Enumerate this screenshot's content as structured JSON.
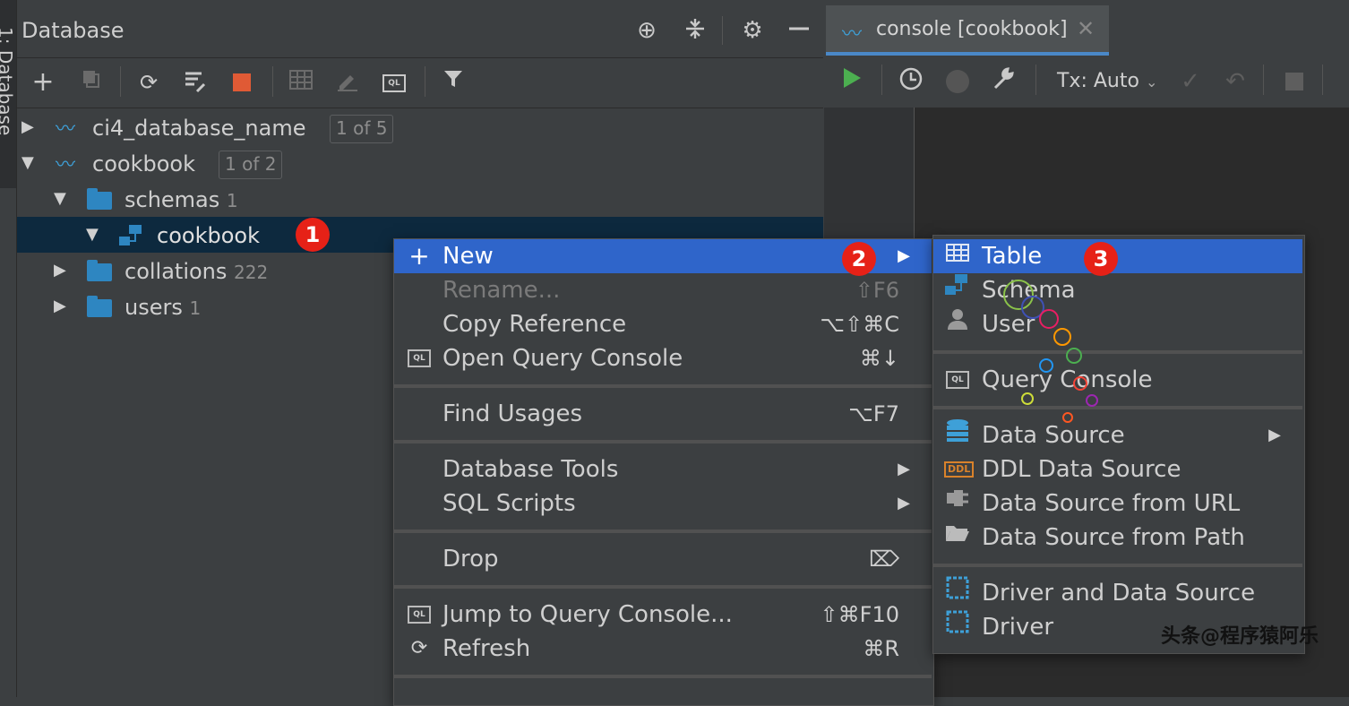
{
  "left_strip": {
    "label": "1: Database"
  },
  "db_panel": {
    "title": "Database",
    "header_icons": [
      "crosshair-icon",
      "collapse-icon",
      "gear-icon",
      "minimize-icon"
    ],
    "toolbar_icons": [
      "add-icon",
      "duplicate-icon",
      "refresh-icon",
      "schema-tools-icon",
      "stop-icon",
      "table-icon",
      "edit-icon",
      "console-icon",
      "filter-icon"
    ],
    "tree": [
      {
        "label": "ci4_database_name",
        "badge": "1 of 5",
        "expanded": false
      },
      {
        "label": "cookbook",
        "badge": "1 of 2",
        "expanded": true
      },
      {
        "label": "schemas",
        "count": "1",
        "expanded": true
      },
      {
        "label": "cookbook",
        "marker": "1",
        "selected": true,
        "expanded": true
      },
      {
        "label": "collations",
        "count": "222",
        "expanded": false
      },
      {
        "label": "users",
        "count": "1",
        "expanded": false
      }
    ]
  },
  "console": {
    "tab_label": "console [cookbook]",
    "tx_label": "Tx: Auto",
    "toolbar_icons": [
      "run-icon",
      "history-icon",
      "disabled-circle-icon",
      "wrench-icon",
      "commit-icon",
      "rollback-icon",
      "stop-icon"
    ]
  },
  "context_menu": {
    "items": [
      {
        "label": "New",
        "icon": "plus-icon",
        "marker": "2",
        "submenu": true,
        "highlighted": true
      },
      {
        "label": "Rename...",
        "shortcut": "⇧F6",
        "disabled": true
      },
      {
        "label": "Copy Reference",
        "shortcut": "⌥⇧⌘C"
      },
      {
        "label": "Open Query Console",
        "shortcut": "⌘↓",
        "icon": "QL"
      },
      {
        "label": "Find Usages",
        "shortcut": "⌥F7"
      },
      {
        "label": "Database Tools",
        "submenu": true
      },
      {
        "label": "SQL Scripts",
        "submenu": true
      },
      {
        "label": "Drop",
        "icon_right": "delete-icon"
      },
      {
        "label": "Jump to Query Console...",
        "shortcut": "⇧⌘F10",
        "icon": "QL"
      },
      {
        "label": "Refresh",
        "shortcut": "⌘R",
        "icon": "refresh-icon"
      }
    ]
  },
  "submenu": {
    "items": [
      {
        "label": "Table",
        "marker": "3",
        "highlighted": true,
        "icon": "table-icon"
      },
      {
        "label": "Schema",
        "icon": "schema-icon"
      },
      {
        "label": "User",
        "icon": "user-icon"
      },
      {
        "label": "Query Console",
        "icon": "QL"
      },
      {
        "label": "Data Source",
        "icon": "datasource-icon",
        "submenu": true
      },
      {
        "label": "DDL Data Source",
        "icon": "DDL"
      },
      {
        "label": "Data Source from URL",
        "icon": "plug-icon"
      },
      {
        "label": "Data Source from Path",
        "icon": "folder-open-icon"
      },
      {
        "label": "Driver and Data Source",
        "icon": "driver-icon"
      },
      {
        "label": "Driver",
        "icon": "driver-icon"
      }
    ]
  },
  "watermark": "头条@程序猿阿乐",
  "colors": {
    "highlight": "#2f65ca",
    "selection": "#0d293e",
    "marker": "#e62117",
    "accent": "#3ea0d8"
  }
}
